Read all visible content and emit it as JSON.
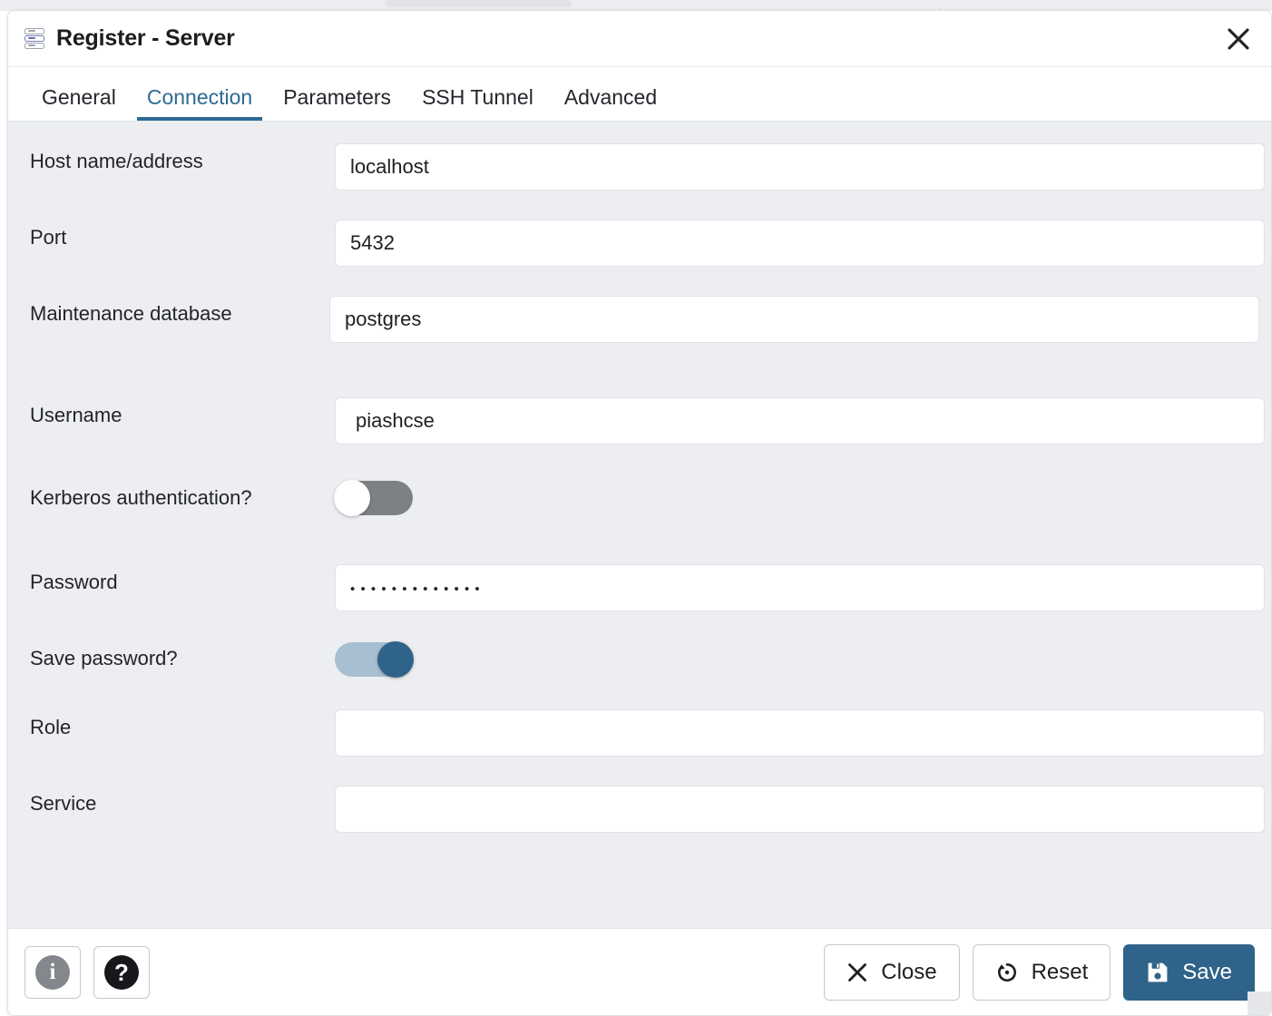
{
  "window": {
    "title": "Register - Server",
    "icon": "server-stack-icon",
    "close_icon": "close-icon"
  },
  "tabs": [
    {
      "label": "General",
      "active": false
    },
    {
      "label": "Connection",
      "active": true
    },
    {
      "label": "Parameters",
      "active": false
    },
    {
      "label": "SSH Tunnel",
      "active": false
    },
    {
      "label": "Advanced",
      "active": false
    }
  ],
  "form": {
    "host": {
      "label": "Host name/address",
      "value": "localhost",
      "placeholder": ""
    },
    "port": {
      "label": "Port",
      "value": "5432",
      "placeholder": ""
    },
    "maintenance_db": {
      "label": "Maintenance database",
      "value": "postgres",
      "placeholder": ""
    },
    "username": {
      "label": "Username",
      "value": "piashcse",
      "placeholder": ""
    },
    "kerberos": {
      "label": "Kerberos authentication?",
      "state": "off"
    },
    "password": {
      "label": "Password",
      "value": "•••••••••••••",
      "placeholder": ""
    },
    "save_password": {
      "label": "Save password?",
      "state": "on"
    },
    "role": {
      "label": "Role",
      "value": "",
      "placeholder": ""
    },
    "service": {
      "label": "Service",
      "value": "",
      "placeholder": ""
    }
  },
  "footer": {
    "info_label": "i",
    "help_label": "?",
    "close_label": "Close",
    "reset_label": "Reset",
    "save_label": "Save"
  },
  "colors": {
    "accent": "#2c6a94",
    "primary_button": "#2f6389",
    "toggle_on_track": "#a8bed1",
    "toggle_off_track": "#7d8085",
    "form_background": "#eceef1"
  }
}
